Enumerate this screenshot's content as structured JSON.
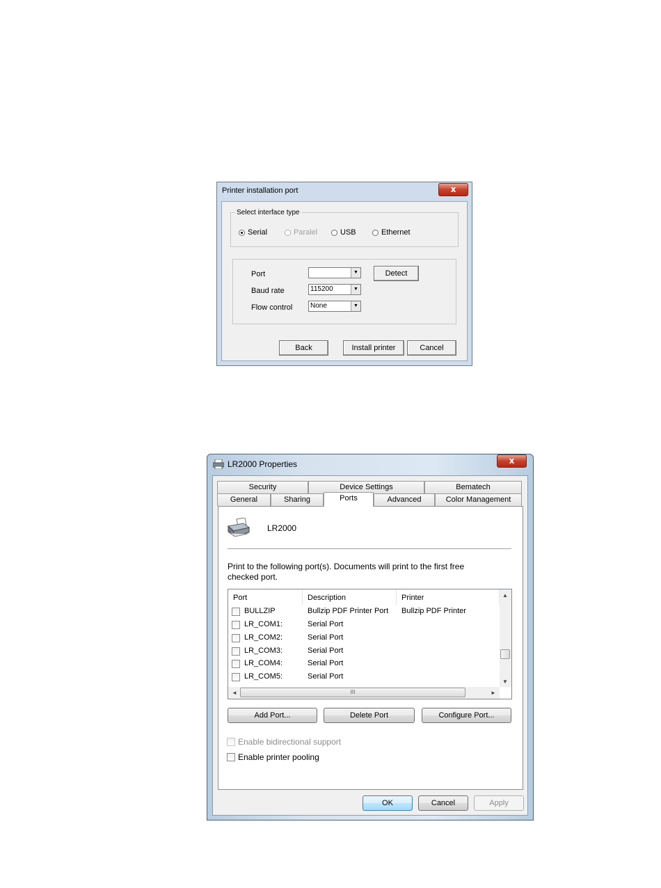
{
  "dialog1": {
    "title": "Printer installation port",
    "group_label": "Select interface type",
    "interfaces": [
      {
        "label": "Serial",
        "selected": true,
        "enabled": true
      },
      {
        "label": "Paralel",
        "selected": false,
        "enabled": false
      },
      {
        "label": "USB",
        "selected": false,
        "enabled": true
      },
      {
        "label": "Ethernet",
        "selected": false,
        "enabled": true
      }
    ],
    "port_label": "Port",
    "port_value": "",
    "baud_label": "Baud rate",
    "baud_value": "115200",
    "flow_label": "Flow control",
    "flow_value": "None",
    "detect_button": "Detect",
    "back_button": "Back",
    "install_button": "Install printer",
    "cancel_button": "Cancel",
    "close_glyph": "x"
  },
  "dialog2": {
    "title": "LR2000 Properties",
    "close_glyph": "x",
    "tabs_top": [
      "Security",
      "Device Settings",
      "Bematech"
    ],
    "tabs_bottom": [
      "General",
      "Sharing",
      "Ports",
      "Advanced",
      "Color Management"
    ],
    "active_tab": "Ports",
    "printer_name": "LR2000",
    "instruction": "Print to the following port(s). Documents will print to the first free checked port.",
    "instruction_line1": "Print to the following port(s). Documents will print to the first free",
    "instruction_line2": "checked port.",
    "columns": [
      "Port",
      "Description",
      "Printer"
    ],
    "ports": [
      {
        "port": "BULLZIP",
        "description": "Bullzip PDF Printer Port",
        "printer": "Bullzip PDF Printer",
        "checked": false
      },
      {
        "port": "LR_COM1:",
        "description": "Serial Port",
        "printer": "",
        "checked": false
      },
      {
        "port": "LR_COM2:",
        "description": "Serial Port",
        "printer": "",
        "checked": false
      },
      {
        "port": "LR_COM3:",
        "description": "Serial Port",
        "printer": "",
        "checked": false
      },
      {
        "port": "LR_COM4:",
        "description": "Serial Port",
        "printer": "",
        "checked": false
      },
      {
        "port": "LR_COM5:",
        "description": "Serial Port",
        "printer": "",
        "checked": false
      }
    ],
    "hscroll_grip": "III",
    "add_port_button": "Add Port...",
    "delete_port_button": "Delete Port",
    "configure_port_button": "Configure Port...",
    "bidirectional_label": "Enable bidirectional support",
    "pooling_label": "Enable printer pooling",
    "ok_button": "OK",
    "cancel_button": "Cancel",
    "apply_button": "Apply"
  }
}
